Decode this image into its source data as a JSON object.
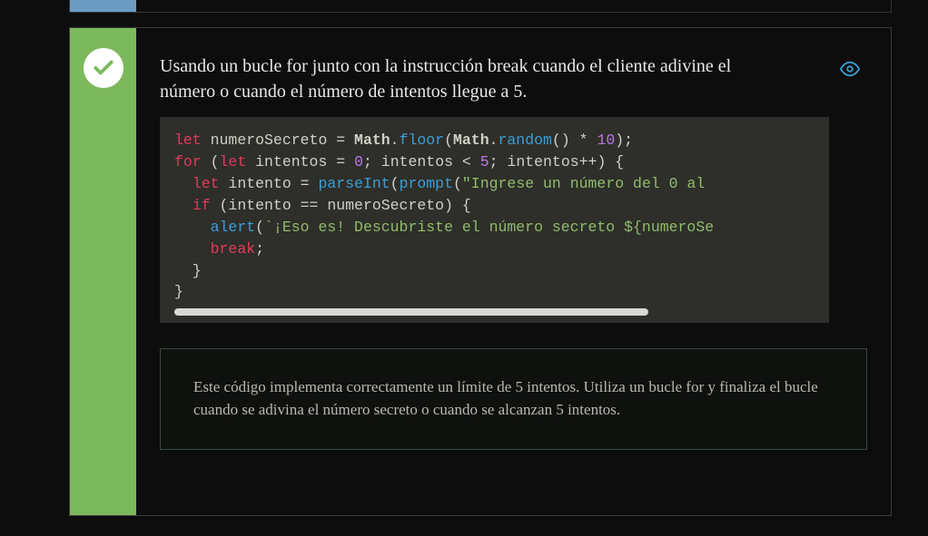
{
  "status": "correct",
  "colors": {
    "sidebar": "#7cb85c",
    "accent": "#3b9fd4"
  },
  "title": "Usando un bucle for junto con la instrucción break cuando el cliente adivine el número o cuando el número de intentos llegue a 5.",
  "code": {
    "line1": {
      "kw1": "let",
      "var1": " numeroSecreto = ",
      "obj1": "Math",
      "dot1": ".",
      "fn1": "floor",
      "paren1": "(",
      "obj2": "Math",
      "dot2": ".",
      "fn2": "random",
      "rest1": "() * ",
      "num1": "10",
      "end1": ");"
    },
    "line2": {
      "kw1": "for",
      "p1": " (",
      "kw2": "let",
      "v1": " intentos = ",
      "num1": "0",
      "v2": "; intentos < ",
      "num2": "5",
      "v3": "; intentos++) {"
    },
    "line3": {
      "indent": "  ",
      "kw1": "let",
      "v1": " intento = ",
      "fn1": "parseInt",
      "p1": "(",
      "fn2": "prompt",
      "p2": "(",
      "str1": "\"Ingrese un número del 0 al "
    },
    "line4": {
      "indent": "  ",
      "kw1": "if",
      "rest": " (intento == numeroSecreto) {"
    },
    "line5": {
      "indent": "    ",
      "fn1": "alert",
      "p1": "(",
      "str1": "`¡Eso es! Descubriste el número secreto ",
      "interp": "${numeroSe"
    },
    "line6": {
      "indent": "    ",
      "kw1": "break",
      "end": ";"
    },
    "line7": "  }",
    "line8": "}"
  },
  "explanation": "Este código implementa correctamente un límite de 5 intentos. Utiliza un bucle for y finaliza el bucle cuando se adivina el número secreto o cuando se alcanzan 5 intentos.",
  "icons": {
    "check": "check-icon",
    "eye": "eye-icon"
  }
}
